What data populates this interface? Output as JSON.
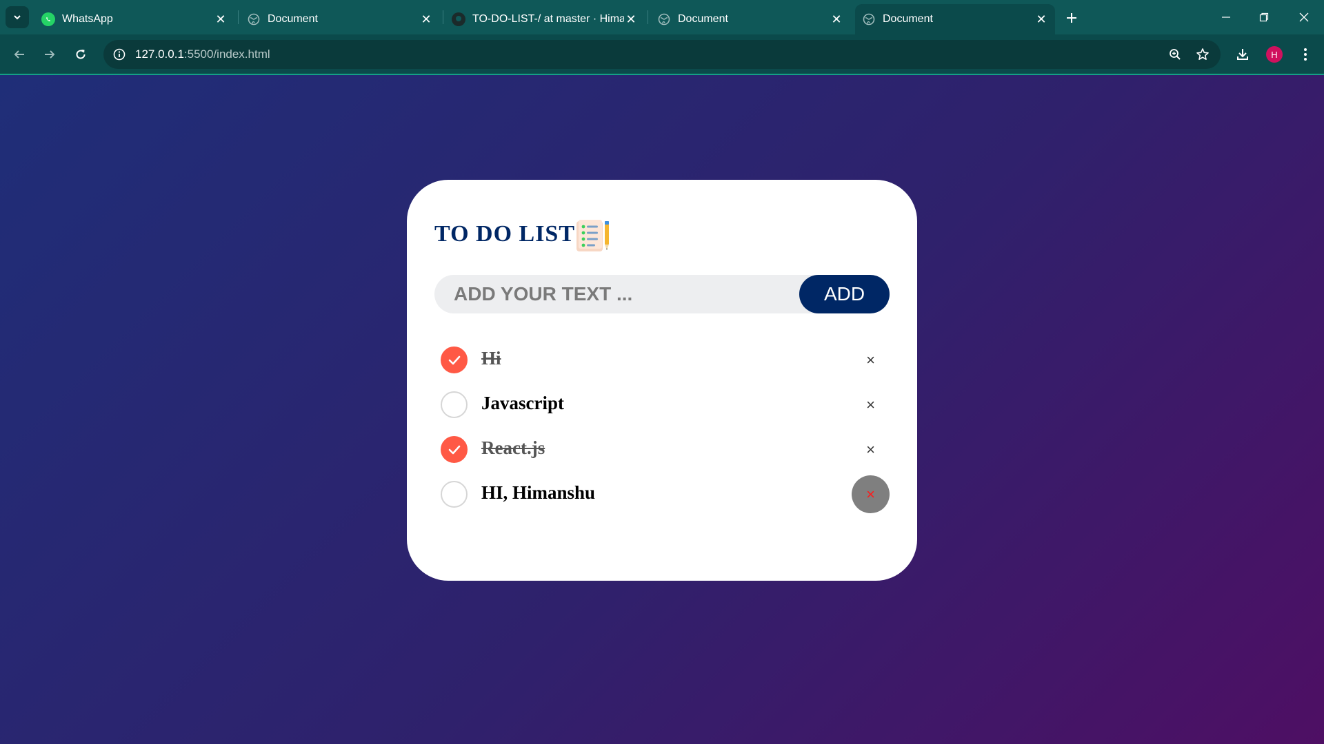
{
  "browser": {
    "tabs": [
      {
        "title": "WhatsApp",
        "favicon": "whatsapp-icon",
        "active": false
      },
      {
        "title": "Document",
        "favicon": "globe-icon",
        "active": false
      },
      {
        "title": "TO-DO-LIST-/ at master · Himar",
        "favicon": "github-icon",
        "active": false
      },
      {
        "title": "Document",
        "favicon": "globe-icon",
        "active": false
      },
      {
        "title": "Document",
        "favicon": "globe-icon",
        "active": true
      }
    ],
    "url_host": "127.0.0.1",
    "url_path": ":5500/index.html",
    "profile_initial": "H"
  },
  "app": {
    "title": "TO DO LIST",
    "input_placeholder": "ADD YOUR TEXT ...",
    "add_label": "ADD",
    "items": [
      {
        "text": "Hi",
        "checked": true
      },
      {
        "text": "Javascript",
        "checked": false
      },
      {
        "text": "React.js",
        "checked": true
      },
      {
        "text": "HI, Himanshu",
        "checked": false
      }
    ],
    "delete_symbol": "×"
  },
  "colors": {
    "brand_navy": "#002765",
    "check_accent": "#ff5945",
    "chrome_tabbar": "#0f5858",
    "gradient_start": "#1f2e78",
    "gradient_end": "#4e0f64"
  }
}
